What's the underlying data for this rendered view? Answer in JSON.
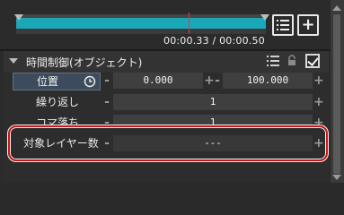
{
  "timeline": {
    "time_readout": "00:00.33 / 00:00.50",
    "list_icon": "list-icon",
    "add_button_label": "+"
  },
  "section": {
    "title": "時間制御(オブジェクト)",
    "icons": [
      "list-icon",
      "lock-icon",
      "checkbox-icon"
    ],
    "enabled": true,
    "accent_color": "#1aa7b6",
    "highlight_color": "#c81818"
  },
  "params": {
    "position": {
      "label": "位置",
      "icon": "clock-icon",
      "start": "0.000",
      "end": "100.000"
    },
    "repeat": {
      "label": "繰り返し",
      "value": "1"
    },
    "frame_drop": {
      "label": "コマ落ち",
      "value": "1"
    },
    "layer_count": {
      "label": "対象レイヤー数",
      "value": "---"
    }
  },
  "controls": {
    "minus": "-",
    "plus": "+"
  }
}
